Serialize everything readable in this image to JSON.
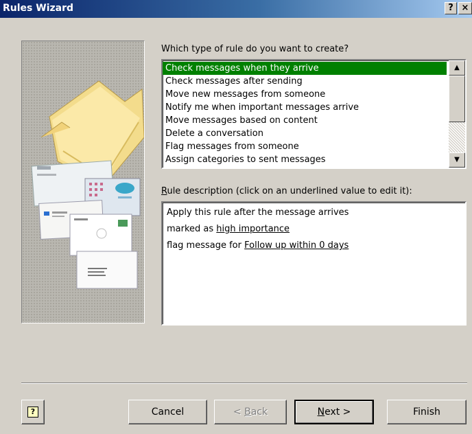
{
  "window": {
    "title": "Rules Wizard",
    "help_glyph": "?",
    "close_glyph": "×"
  },
  "rule_type": {
    "question": "Which type of rule do you want to create?",
    "items": [
      "Check messages when they arrive",
      "Check messages after sending",
      "Move new messages from someone",
      "Notify me when important messages arrive",
      "Move messages based on content",
      "Delete a conversation",
      "Flag messages from someone",
      "Assign categories to sent messages"
    ],
    "selected_index": 0,
    "selected_color": "#008000"
  },
  "description": {
    "label_accel": "R",
    "label_rest": "ule description (click on an underlined value to edit it):",
    "line1": "Apply this rule after the message arrives",
    "line2_text": "marked as ",
    "line2_link": "high importance",
    "line3_text": "flag message for ",
    "line3_link": "Follow up within 0 days"
  },
  "buttons": {
    "help_glyph": "?",
    "cancel": "Cancel",
    "back_prefix": "< ",
    "back_accel": "B",
    "back_rest": "ack",
    "next_accel": "N",
    "next_rest": "ext >",
    "finish": "Finish"
  },
  "scroll_icons": {
    "up": "▲",
    "down": "▼"
  }
}
